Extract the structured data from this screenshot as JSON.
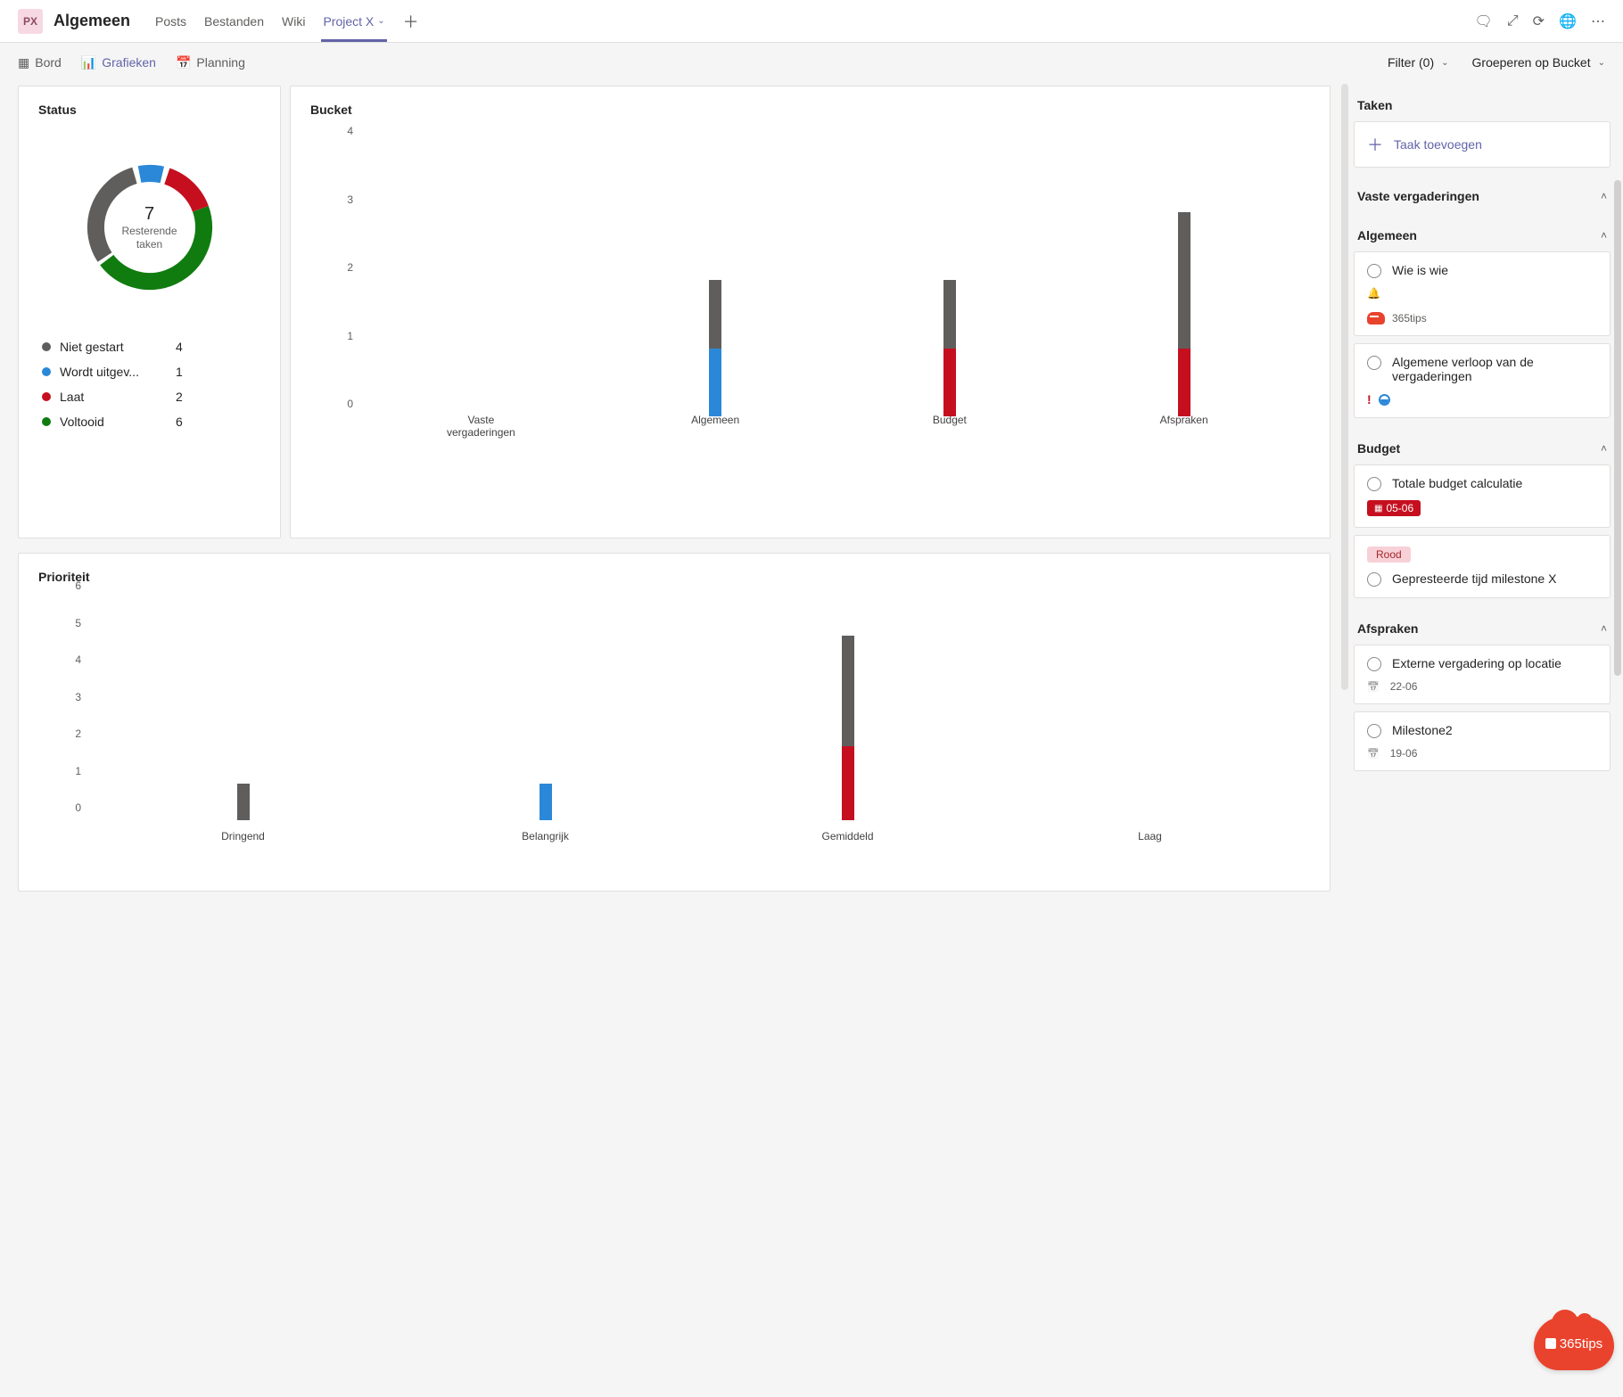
{
  "header": {
    "team_badge": "PX",
    "channel": "Algemeen",
    "tabs": [
      "Posts",
      "Bestanden",
      "Wiki"
    ],
    "active_tab": "Project X"
  },
  "toolbar": {
    "views": {
      "board": "Bord",
      "charts": "Grafieken",
      "schedule": "Planning"
    },
    "filter_label": "Filter (0)",
    "group_label": "Groeperen op Bucket"
  },
  "cards": {
    "status_title": "Status",
    "bucket_title": "Bucket",
    "priority_title": "Prioriteit"
  },
  "donut": {
    "center_value": "7",
    "center_label_1": "Resterende",
    "center_label_2": "taken",
    "legend": [
      {
        "label": "Niet gestart",
        "value": "4",
        "color": "#605e5c"
      },
      {
        "label": "Wordt uitgev...",
        "value": "1",
        "color": "#2b88d8"
      },
      {
        "label": "Laat",
        "value": "2",
        "color": "#c50f1f"
      },
      {
        "label": "Voltooid",
        "value": "6",
        "color": "#107c10"
      }
    ]
  },
  "rail": {
    "heading": "Taken",
    "add_task": "Taak toevoegen",
    "sections": {
      "vaste": "Vaste vergaderingen",
      "algemeen": "Algemeen",
      "budget": "Budget",
      "afspraken": "Afspraken"
    },
    "tasks": {
      "wie": "Wie is wie",
      "wie_tag": "365tips",
      "verloop": "Algemene verloop van de vergaderingen",
      "totale": "Totale budget calculatie",
      "totale_date": "05-06",
      "rood": "Rood",
      "gepresteerde": "Gepresteerde tijd milestone X",
      "externe": "Externe vergadering op locatie",
      "externe_date": "22-06",
      "milestone2": "Milestone2",
      "milestone2_date": "19-06"
    }
  },
  "brand": "365tips",
  "chart_data": [
    {
      "id": "status_donut",
      "type": "pie",
      "title": "Status",
      "series": [
        {
          "name": "Niet gestart",
          "value": 4,
          "color": "#605e5c"
        },
        {
          "name": "Wordt uitgevoerd",
          "value": 1,
          "color": "#2b88d8"
        },
        {
          "name": "Laat",
          "value": 2,
          "color": "#c50f1f"
        },
        {
          "name": "Voltooid",
          "value": 6,
          "color": "#107c10"
        }
      ],
      "center_label": "7 Resterende taken"
    },
    {
      "id": "bucket_bar",
      "type": "bar",
      "title": "Bucket",
      "categories": [
        "Vaste vergaderingen",
        "Algemeen",
        "Budget",
        "Afspraken"
      ],
      "series": [
        {
          "name": "lower",
          "values": [
            0,
            1,
            1,
            1
          ],
          "colors": [
            "",
            "#2b88d8",
            "#c50f1f",
            "#c50f1f"
          ]
        },
        {
          "name": "upper",
          "values": [
            0,
            1,
            1,
            2
          ],
          "color": "#605e5c"
        }
      ],
      "stacked_totals": [
        0,
        2,
        2,
        3
      ],
      "ylim": [
        0,
        4
      ],
      "yticks": [
        0,
        1,
        2,
        3,
        4
      ]
    },
    {
      "id": "priority_bar",
      "type": "bar",
      "title": "Prioriteit",
      "categories": [
        "Dringend",
        "Belangrijk",
        "Gemiddeld",
        "Laag"
      ],
      "series": [
        {
          "name": "lower",
          "values": [
            0,
            0,
            2,
            0
          ],
          "color": "#c50f1f"
        },
        {
          "name": "upper",
          "values": [
            1,
            1,
            3,
            0
          ],
          "colors": [
            "#605e5c",
            "#2b88d8",
            "#605e5c",
            ""
          ]
        }
      ],
      "stacked_totals": [
        1,
        1,
        5,
        0
      ],
      "ylim": [
        0,
        6
      ],
      "yticks": [
        0,
        1,
        2,
        3,
        4,
        5,
        6
      ]
    }
  ]
}
